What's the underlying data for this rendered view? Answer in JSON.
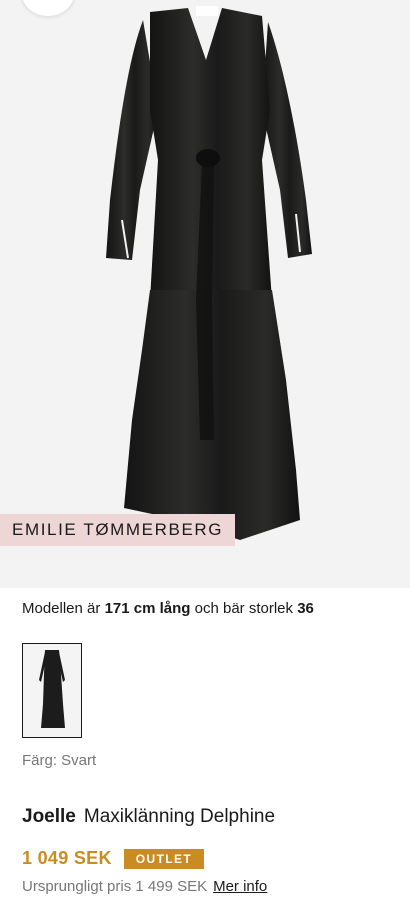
{
  "product": {
    "influencer_label": "EMILIE TØMMERBERG",
    "model_info": {
      "prefix": "Modellen är",
      "height": "171 cm lång",
      "middle": "och bär storlek",
      "size": "36"
    },
    "color_label": "Färg: Svart",
    "brand": "Joelle",
    "name": "Maxiklänning Delphine",
    "price": "1 049 SEK",
    "badge": "OUTLET",
    "original_price": "Ursprungligt pris 1 499 SEK",
    "more_info_link": "Mer info"
  },
  "colors": {
    "price": "#c98c22",
    "badge_bg": "#c98c22",
    "influencer_bg": "#efd6d6",
    "hero_bg": "#f3f3f3"
  },
  "icons": {
    "favorite": "heart-icon"
  }
}
